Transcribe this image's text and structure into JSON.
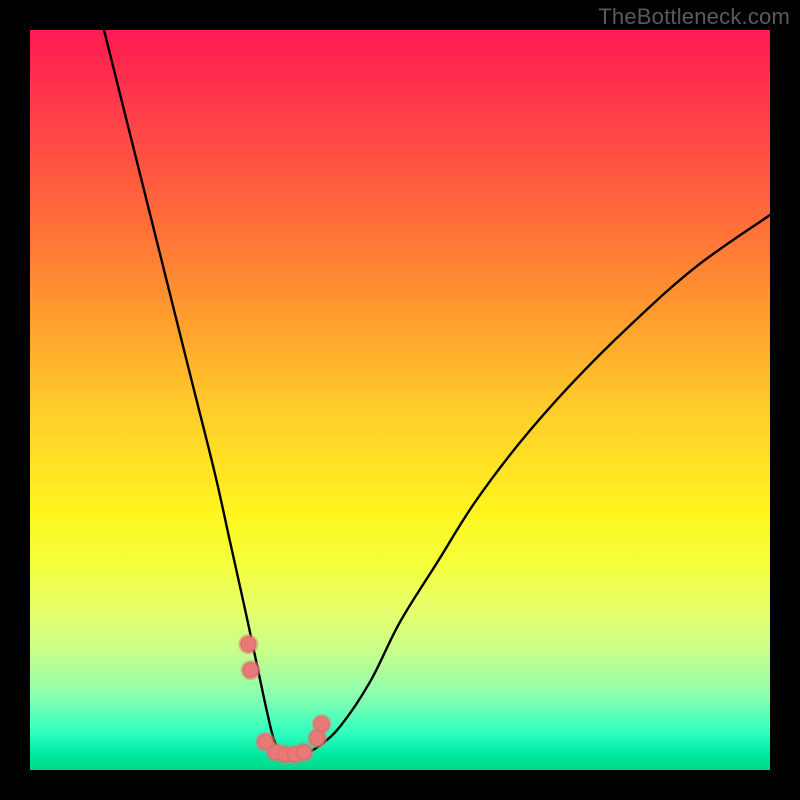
{
  "watermark": "TheBottleneck.com",
  "colors": {
    "frame": "#000000",
    "curve": "#000000",
    "marker_fill": "#e77a77",
    "marker_stroke": "#d86a66"
  },
  "chart_data": {
    "type": "line",
    "title": "",
    "xlabel": "",
    "ylabel": "",
    "xlim": [
      0,
      100
    ],
    "ylim": [
      0,
      100
    ],
    "grid": false,
    "legend": false,
    "curve_note": "V-shaped bottleneck curve; y ≈ 100 at x≈10, dips to ~2 near x≈33, rises to ~75 at x≈100",
    "series": [
      {
        "name": "bottleneck-curve",
        "x": [
          10,
          13,
          16,
          19,
          22,
          25,
          27,
          29,
          30.5,
          32,
          33,
          34,
          35.5,
          37,
          39,
          42,
          46,
          50,
          55,
          60,
          66,
          73,
          81,
          90,
          100
        ],
        "y": [
          100,
          88,
          76,
          64,
          52,
          40,
          31,
          22,
          15,
          8,
          4,
          2.5,
          2,
          2.2,
          3.2,
          6,
          12,
          20,
          28,
          36,
          44,
          52,
          60,
          68,
          75
        ]
      }
    ],
    "markers": {
      "name": "highlight-points",
      "x": [
        29.5,
        29.8,
        31.8,
        33.2,
        34.5,
        35.8,
        37.0,
        38.8,
        39.4
      ],
      "y": [
        17,
        13.5,
        3.8,
        2.4,
        2.1,
        2.1,
        2.4,
        4.3,
        6.2
      ]
    }
  }
}
